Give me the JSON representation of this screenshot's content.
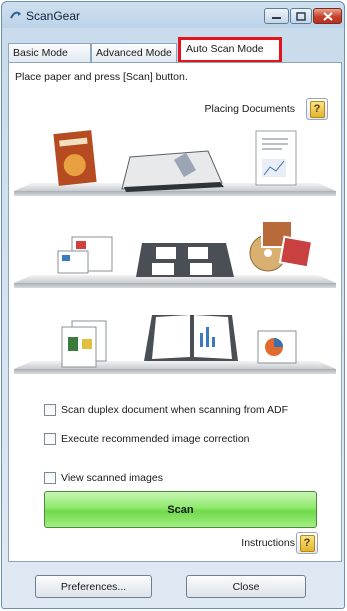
{
  "window": {
    "title": "ScanGear"
  },
  "tabs": [
    {
      "label": "Basic Mode"
    },
    {
      "label": "Advanced Mode"
    },
    {
      "label": "Auto Scan Mode"
    }
  ],
  "panel": {
    "instruction": "Place paper and press [Scan] button.",
    "placing_documents": "Placing Documents",
    "help_glyph": "?"
  },
  "options": {
    "duplex": "Scan duplex document when scanning from ADF",
    "correction": "Execute recommended image correction",
    "view": "View scanned images"
  },
  "scan_button": "Scan",
  "instructions_label": "Instructions",
  "bottom": {
    "preferences": "Preferences...",
    "close": "Close"
  },
  "colors": {
    "highlight": "#e3141b",
    "scan_green": "#8fe96c"
  }
}
